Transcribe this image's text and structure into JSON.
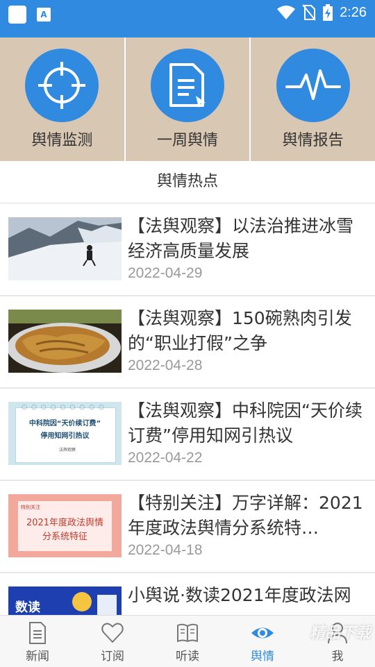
{
  "status_bar": {
    "time": "2:26",
    "app_icon_label": "A",
    "icons": [
      "notification-app-icon",
      "text-app-icon",
      "wifi-icon",
      "no-sim-icon",
      "battery-charging-icon"
    ]
  },
  "colors": {
    "accent": "#2f8ae0",
    "tile_bg": "#d8c7b2",
    "text": "#333333",
    "date": "#999999"
  },
  "features": [
    {
      "label": "舆情监测",
      "icon": "crosshair-icon"
    },
    {
      "label": "一周舆情",
      "icon": "document-icon"
    },
    {
      "label": "舆情报告",
      "icon": "pulse-icon"
    }
  ],
  "section_title": "舆情热点",
  "news": [
    {
      "title": "【法舆观察】以法治推进冰雪经济高质量发展",
      "date": "2022-04-29"
    },
    {
      "title": "【法舆观察】150碗熟肉引发的“职业打假”之争",
      "date": "2022-04-28"
    },
    {
      "title": "【法舆观察】中科院因“天价续订费”停用知网引热议",
      "date": "2022-04-22",
      "thumb_text": [
        "中科院因“天价续订费”",
        "停用知网引热议",
        "法舆观察"
      ]
    },
    {
      "title": "【特别关注】万字详解：2021年度政法舆情分系统特…",
      "date": "2022-04-18",
      "thumb_text": [
        "特别关注",
        "2021年度政法舆情",
        "分系统特征"
      ]
    },
    {
      "title": "小舆说·数读2021年度政法网",
      "date": "",
      "thumb_text": [
        "数读"
      ]
    }
  ],
  "bottom_nav": [
    {
      "label": "新闻",
      "icon": "newspaper-icon",
      "active": false
    },
    {
      "label": "订阅",
      "icon": "heart-icon",
      "active": false
    },
    {
      "label": "听读",
      "icon": "book-icon",
      "active": false
    },
    {
      "label": "舆情",
      "icon": "eye-icon",
      "active": true
    },
    {
      "label": "我",
      "icon": "person-icon",
      "active": false
    }
  ],
  "watermark": "精品下载"
}
